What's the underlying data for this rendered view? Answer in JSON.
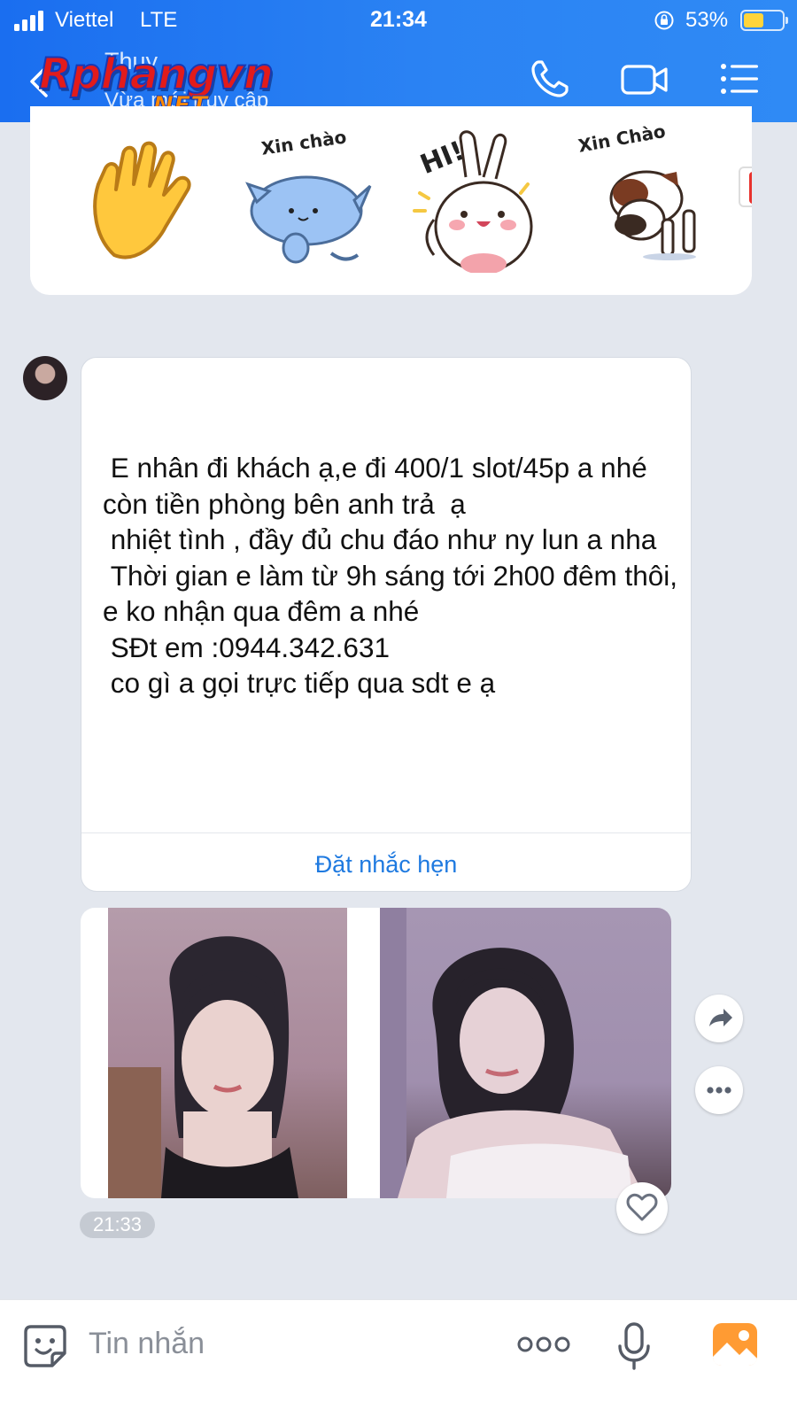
{
  "status_bar": {
    "carrier": "Viettel",
    "network": "LTE",
    "time": "21:34",
    "battery_percent": "53%",
    "battery_level": 0.53,
    "signal_bars": 4
  },
  "header": {
    "contact_name": "Thuy",
    "contact_status": "Vừa mới truy cập",
    "icons": [
      "back-icon",
      "phone-icon",
      "video-call-icon",
      "menu-icon"
    ]
  },
  "watermark": {
    "main": "Rphangvn",
    "sub": ".NET"
  },
  "stickers": {
    "items": [
      {
        "name": "waving-hand-sticker",
        "caption": ""
      },
      {
        "name": "blue-cat-sticker",
        "caption": "Xin chào"
      },
      {
        "name": "bunny-hi-sticker",
        "caption": "HI!"
      },
      {
        "name": "dog-bow-sticker",
        "caption": "Xin Chào"
      }
    ]
  },
  "message": {
    "text": " E nhân đi khách ạ,e đi 400/1 slot/45p a nhé\ncòn tiền phòng bên anh trả  ạ\n nhiệt tình , đầy đủ chu đáo như ny lun a nha\n Thời gian e làm từ 9h sáng tới 2h00 đêm thôi, e ko nhận qua đêm a nhé\n SĐt em :0944.342.631\n co gì a gọi trực tiếp qua sdt e ạ",
    "action_label": "Đặt nhắc hẹn"
  },
  "photos": {
    "count": 2,
    "time": "21:33"
  },
  "composer": {
    "placeholder": "Tin nhắn",
    "icons": [
      "sticker-icon",
      "more-icon",
      "microphone-icon",
      "gallery-icon"
    ]
  },
  "colors": {
    "header_blue": "#2b83f3",
    "link_blue": "#1f7ae0",
    "chat_bg": "#e3e7ee",
    "battery_yellow": "#ffd43b"
  }
}
